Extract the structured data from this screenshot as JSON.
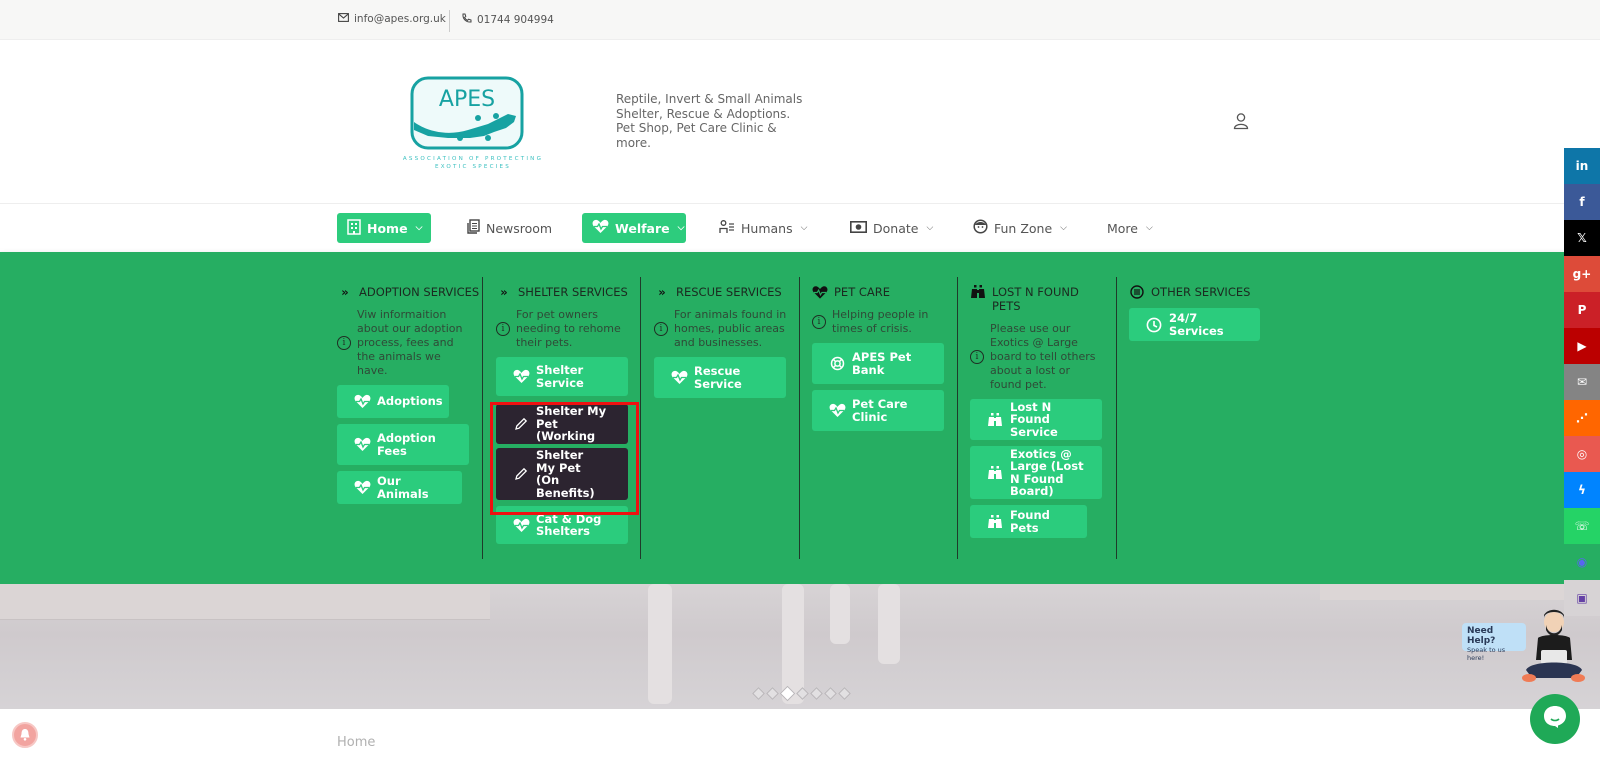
{
  "topbar": {
    "email": "info@apes.org.uk",
    "phone": "01744 904994"
  },
  "header": {
    "logo_text": "APES",
    "logo_subtitle_1": "ASSOCIATION OF PROTECTING",
    "logo_subtitle_2": "EXOTIC SPECIES",
    "tagline": "Reptile, Invert & Small Animals Shelter, Rescue & Adoptions. Pet Shop, Pet Care Clinic & more."
  },
  "nav": {
    "items": [
      {
        "label": "Home",
        "icon": "building-icon",
        "active": true,
        "has_dropdown": true
      },
      {
        "label": "Newsroom",
        "icon": "newspaper-icon",
        "active": false,
        "has_dropdown": false
      },
      {
        "label": "Welfare",
        "icon": "heartbeat-icon",
        "active": true,
        "has_dropdown": true
      },
      {
        "label": "Humans",
        "icon": "person-list-icon",
        "active": false,
        "has_dropdown": true
      },
      {
        "label": "Donate",
        "icon": "money-icon",
        "active": false,
        "has_dropdown": true
      },
      {
        "label": "Fun Zone",
        "icon": "face-icon",
        "active": false,
        "has_dropdown": true
      },
      {
        "label": "More",
        "icon": "",
        "active": false,
        "has_dropdown": true
      }
    ]
  },
  "mega_menu": {
    "columns": [
      {
        "title": "ADOPTION SERVICES",
        "icon": "double-chevron-icon",
        "description": "Viw informaition about our adoption process, fees and the animals we have.",
        "buttons": [
          {
            "label": "Adoptions",
            "icon": "heartbeat-icon"
          },
          {
            "label": "Adoption Fees",
            "icon": "heartbeat-icon"
          },
          {
            "label": "Our Animals",
            "icon": "heartbeat-icon"
          }
        ]
      },
      {
        "title": "SHELTER SERVICES",
        "icon": "double-chevron-icon",
        "description": "For pet owners needing to rehome their pets.",
        "buttons": [
          {
            "label": "Shelter Service",
            "icon": "heartbeat-icon"
          },
          {
            "label": "Shelter My Pet (Working",
            "icon": "pencil-icon",
            "hovered": true
          },
          {
            "label": "Shelter My Pet (On Benefits)",
            "icon": "pencil-icon",
            "hovered": true
          },
          {
            "label": "Cat & Dog Shelters",
            "icon": "heartbeat-icon"
          }
        ]
      },
      {
        "title": "RESCUE SERVICES",
        "icon": "double-chevron-icon",
        "description": "For animals found in homes, public areas and businesses.",
        "buttons": [
          {
            "label": "Rescue Service",
            "icon": "heartbeat-icon"
          }
        ]
      },
      {
        "title": "PET CARE",
        "icon": "heartbeat-icon",
        "description": "Helping people in times of crisis.",
        "buttons": [
          {
            "label": "APES Pet Bank",
            "icon": "lifebuoy-icon"
          },
          {
            "label": "Pet Care Clinic",
            "icon": "heartbeat-icon"
          }
        ]
      },
      {
        "title": "LOST N FOUND PETS",
        "icon": "binoculars-icon",
        "description": "Please use our Exotics @ Large board to tell others about a lost or found pet.",
        "buttons": [
          {
            "label": "Lost N Found Service",
            "icon": "binoculars-icon"
          },
          {
            "label": "Exotics @ Large (Lost N Found Board)",
            "icon": "binoculars-icon"
          },
          {
            "label": "Found Pets",
            "icon": "binoculars-icon"
          }
        ]
      },
      {
        "title": "OTHER SERVICES",
        "icon": "list-circle-icon",
        "description": "",
        "buttons": [
          {
            "label": "24/7 Services",
            "icon": "clock-icon"
          }
        ]
      }
    ]
  },
  "slider": {
    "dot_count": 7,
    "active_index": 2
  },
  "breadcrumb": "Home",
  "social": [
    {
      "name": "linkedin",
      "glyph": "in",
      "color": "#0e76a8"
    },
    {
      "name": "facebook",
      "glyph": "f",
      "color": "#3b5998"
    },
    {
      "name": "x",
      "glyph": "𝕏",
      "color": "#000000"
    },
    {
      "name": "google-plus",
      "glyph": "g+",
      "color": "#dd4b39"
    },
    {
      "name": "pinterest",
      "glyph": "P",
      "color": "#cb2027"
    },
    {
      "name": "youtube",
      "glyph": "▶",
      "color": "#bb0000"
    },
    {
      "name": "email",
      "glyph": "✉",
      "color": "#848484"
    },
    {
      "name": "rss",
      "glyph": "⋰",
      "color": "#ff6600"
    },
    {
      "name": "instagram",
      "glyph": "◎",
      "color": "#e95950"
    },
    {
      "name": "messenger",
      "glyph": "ϟ",
      "color": "#0084ff"
    },
    {
      "name": "whatsapp",
      "glyph": "☏",
      "color": "#25d366"
    },
    {
      "name": "discord",
      "glyph": "◉",
      "color": "#26ae62"
    },
    {
      "name": "twitch",
      "glyph": "▣",
      "color": "#d7d3d5"
    }
  ],
  "help_widget": {
    "title": "Need Help?",
    "subtitle": "Speak to us here!"
  }
}
